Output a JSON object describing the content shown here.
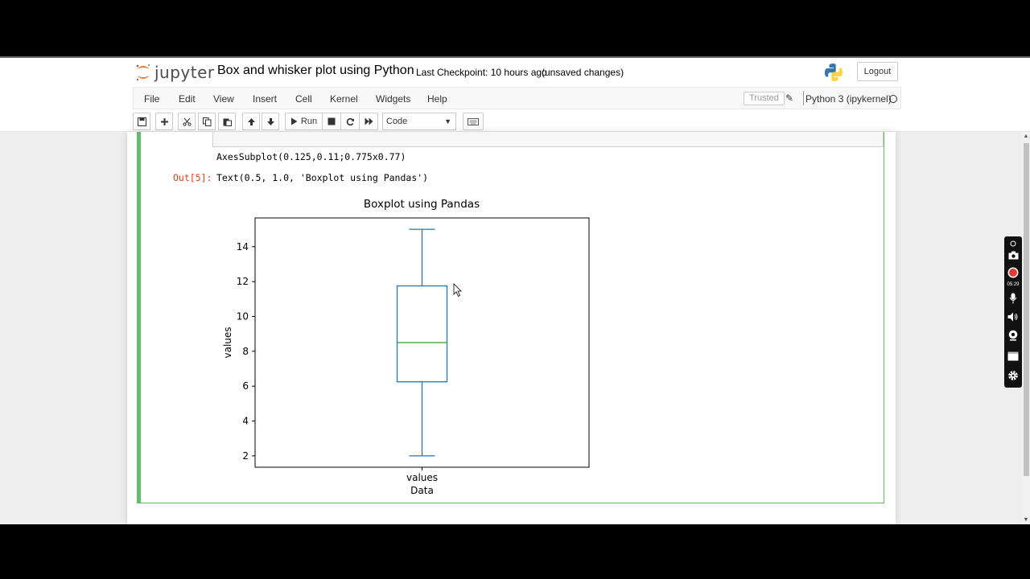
{
  "app": {
    "logo_text": "jupyter",
    "notebook_title": "Box and whisker plot using Python",
    "checkpoint": "Last Checkpoint: 10 hours ago",
    "unsaved": "(unsaved changes)",
    "logout_label": "Logout"
  },
  "menu": {
    "items": [
      "File",
      "Edit",
      "View",
      "Insert",
      "Cell",
      "Kernel",
      "Widgets",
      "Help"
    ],
    "trusted": "Trusted",
    "kernel": "Python 3 (ipykernel)"
  },
  "toolbar": {
    "run_label": "Run",
    "cell_type": "Code",
    "buttons": [
      "save-icon",
      "plus-icon",
      "scissors-icon",
      "copy-icon",
      "paste-icon",
      "arrow-up-icon",
      "arrow-down-icon",
      "run-icon",
      "stop-icon",
      "restart-icon",
      "fast-forward-icon",
      "keyboard-icon"
    ]
  },
  "cell": {
    "output_text_1": "AxesSubplot(0.125,0.11;0.775x0.77)",
    "out_prompt": "Out[5]:",
    "output_text_2": "Text(0.5, 1.0, 'Boxplot using Pandas')"
  },
  "recorder": {
    "time": "05:29"
  },
  "colors": {
    "accent_green": "#66bb6a",
    "box_blue": "#1f77b4",
    "median_green": "#2ca02c",
    "prompt_red": "#d84315"
  },
  "chart_data": {
    "type": "box",
    "title": "Boxplot using Pandas",
    "xlabel": "Data",
    "ylabel": "values",
    "categories": [
      "values"
    ],
    "yticks": [
      2,
      4,
      6,
      8,
      10,
      12,
      14
    ],
    "ylim": [
      1.35,
      15.65
    ],
    "box": {
      "min": 2.0,
      "q1": 6.25,
      "median": 8.5,
      "q3": 11.75,
      "max": 15.0
    },
    "grid": false
  }
}
